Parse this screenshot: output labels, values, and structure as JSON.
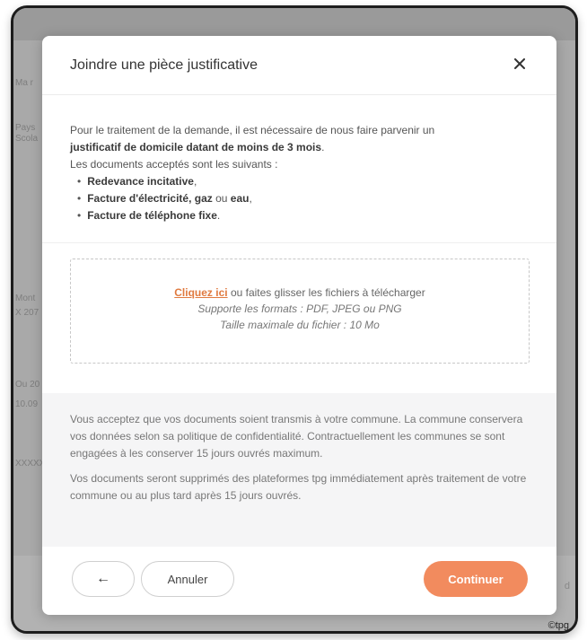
{
  "background": {
    "topbar_text": "",
    "left_fragments": [
      "Ma r",
      "Pays",
      "Scola",
      "Mont",
      "X 207",
      "Ou 20",
      "10.09",
      "XXXXX"
    ],
    "right_fragment": "d"
  },
  "modal": {
    "title": "Joindre une pièce justificative",
    "close_icon": "close-icon",
    "intro": {
      "line1": "Pour le traitement de la demande, il est nécessaire de nous faire parvenir un",
      "line2_bold": "justificatif de domicile datant de moins de 3 mois",
      "line2_end": ".",
      "line3": "Les documents acceptés sont les suivants :",
      "bullets": [
        {
          "parts": [
            {
              "text": "Redevance incitative",
              "bold": true
            },
            {
              "text": ",",
              "bold": false
            }
          ]
        },
        {
          "parts": [
            {
              "text": "Facture d'électricité, gaz",
              "bold": true
            },
            {
              "text": " ou ",
              "bold": false
            },
            {
              "text": "eau",
              "bold": true
            },
            {
              "text": ",",
              "bold": false
            }
          ]
        },
        {
          "parts": [
            {
              "text": "Facture de téléphone fixe",
              "bold": true
            },
            {
              "text": ".",
              "bold": false
            }
          ]
        }
      ]
    },
    "dropzone": {
      "link": "Cliquez ici",
      "text": " ou faites glisser les fichiers à télécharger",
      "formats": "Supporte les formats : PDF, JPEG ou PNG",
      "max_size": "Taille maximale du fichier : 10 Mo"
    },
    "notice": {
      "p1": "Vous acceptez que vos documents soient transmis à votre commune. La commune conservera vos données selon sa politique de confidentialité. Contractuellement les communes se sont engagées à les conserver 15 jours ouvrés maximum.",
      "p2": "Vos documents seront supprimés des plateformes tpg immédiatement après traitement de votre commune ou au plus tard après 15 jours ouvrés."
    },
    "footer": {
      "back_label": "←",
      "cancel_label": "Annuler",
      "continue_label": "Continuer"
    }
  },
  "credit": "©tpg",
  "colors": {
    "accent": "#f28b5e",
    "link": "#e07a3f",
    "notice_bg": "#f5f5f6"
  }
}
